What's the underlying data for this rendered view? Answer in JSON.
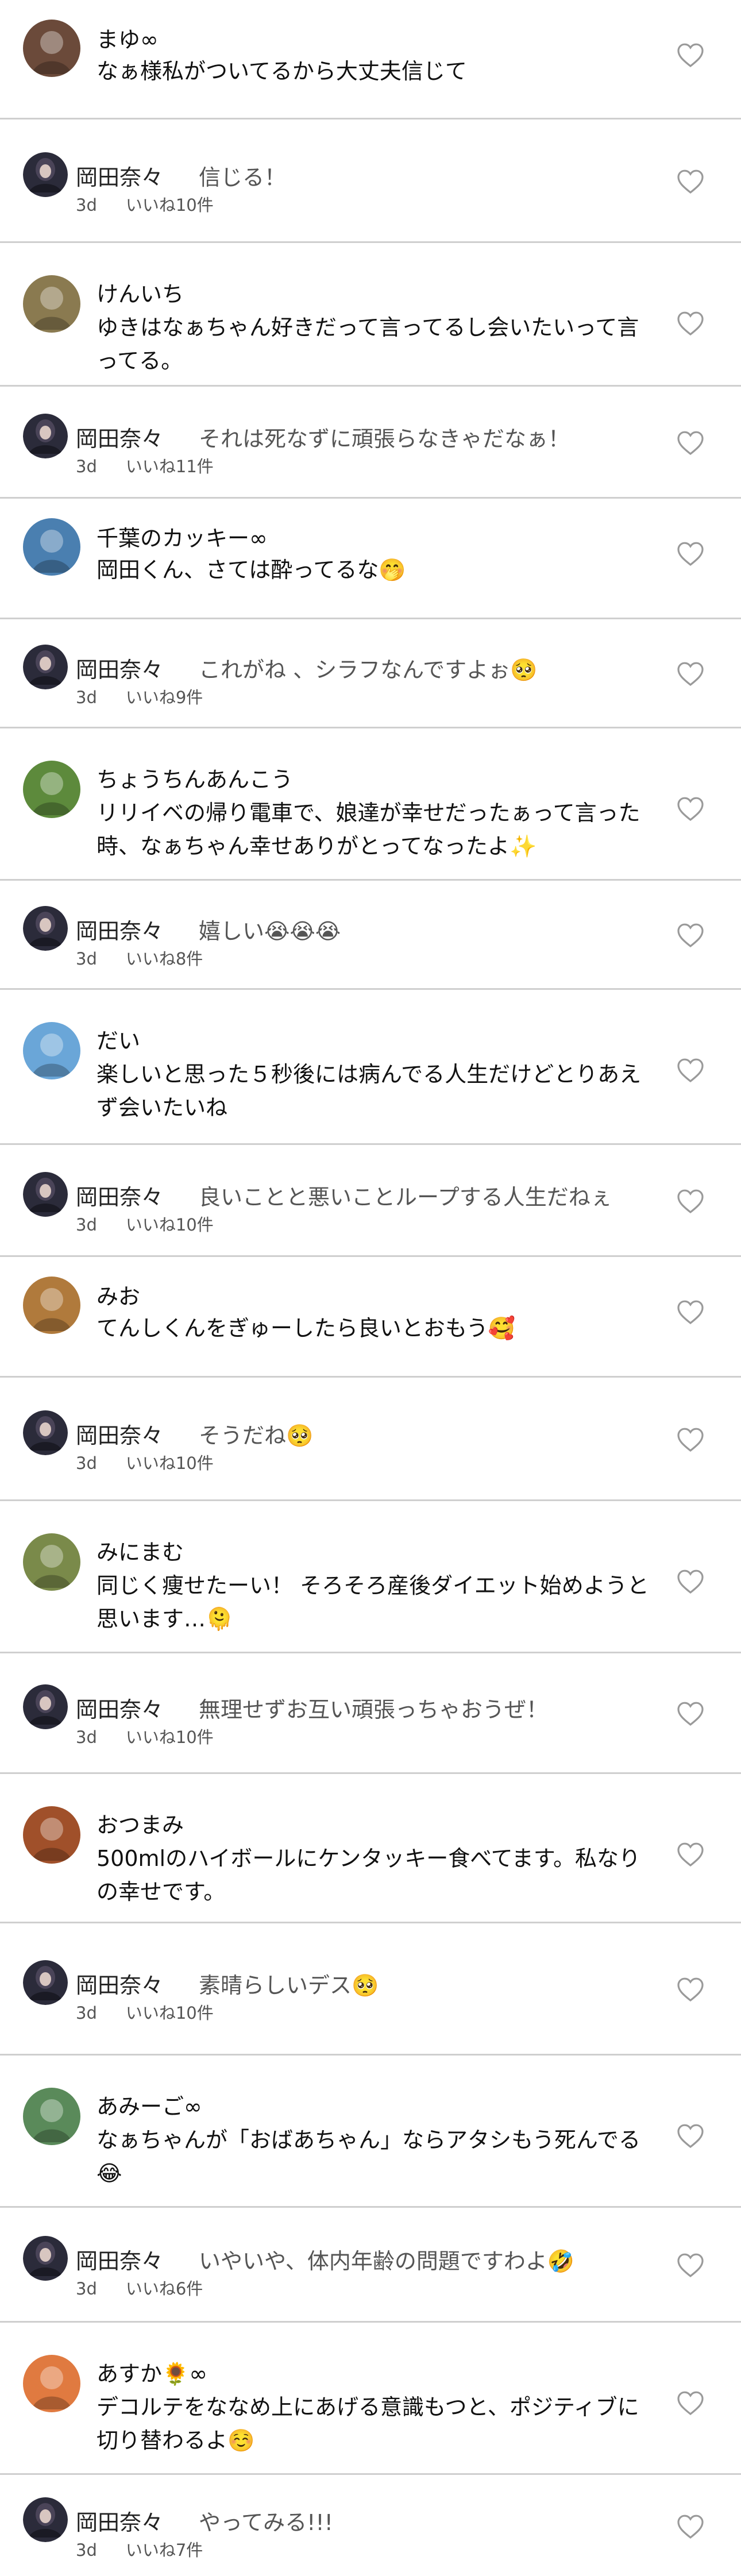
{
  "comments": [
    {
      "kind": "comment",
      "user": "まゆ∞",
      "text": "なぁ様私がついてるから大丈夫信じて",
      "avatar_color": "#6b4a3a"
    },
    {
      "kind": "reply",
      "user": "岡田奈々",
      "text": "信じる！",
      "time": "3d",
      "likes": "いいね10件"
    },
    {
      "kind": "comment",
      "user": "けんいち",
      "text": "ゆきはなぁちゃん好きだって言ってるし会いたいって言ってる。",
      "avatar_color": "#8a7a50"
    },
    {
      "kind": "reply",
      "user": "岡田奈々",
      "text": "それは死なずに頑張らなきゃだなぁ！",
      "time": "3d",
      "likes": "いいね11件"
    },
    {
      "kind": "comment",
      "user": "千葉のカッキー∞",
      "text": "岡田くん、さては酔ってるな🤭",
      "avatar_color": "#4a7fb0"
    },
    {
      "kind": "reply",
      "user": "岡田奈々",
      "text": "これがね 、シラフなんですよぉ🥺",
      "time": "3d",
      "likes": "いいね9件"
    },
    {
      "kind": "comment",
      "user": "ちょうちんあんこう",
      "text": "リリイベの帰り電車で、娘達が幸せだったぁって言った時、なぁちゃん幸せありがとってなったよ✨",
      "avatar_color": "#5d8a3c"
    },
    {
      "kind": "reply",
      "user": "岡田奈々",
      "text": "嬉しい😭😭😭",
      "time": "3d",
      "likes": "いいね8件"
    },
    {
      "kind": "comment",
      "user": "だい",
      "text": "楽しいと思った５秒後には病んでる人生だけどとりあえず会いたいね",
      "avatar_color": "#6aa6d8"
    },
    {
      "kind": "reply",
      "user": "岡田奈々",
      "text": "良いことと悪いことループする人生だねぇ",
      "time": "3d",
      "likes": "いいね10件"
    },
    {
      "kind": "comment",
      "user": "みお",
      "text": "てんしくんをぎゅーしたら良いとおもう🥰",
      "avatar_color": "#b07a3c"
    },
    {
      "kind": "reply",
      "user": "岡田奈々",
      "text": "そうだね🥺",
      "time": "3d",
      "likes": "いいね10件"
    },
    {
      "kind": "comment",
      "user": "みにまむ",
      "text": "同じく痩せたーい！ そろそろ産後ダイエット始めようと思います…🫠",
      "avatar_color": "#7a8a4a"
    },
    {
      "kind": "reply",
      "user": "岡田奈々",
      "text": "無理せずお互い頑張っちゃおうぜ！",
      "time": "3d",
      "likes": "いいね10件"
    },
    {
      "kind": "comment",
      "user": "おつまみ",
      "text": "500mlのハイボールにケンタッキー食べてます。私なりの幸せです。",
      "avatar_color": "#a0502a"
    },
    {
      "kind": "reply",
      "user": "岡田奈々",
      "text": "素晴らしいデス🥺",
      "time": "3d",
      "likes": "いいね10件"
    },
    {
      "kind": "comment",
      "user": "あみーご∞",
      "text": "なぁちゃんが「おばあちゃん」ならアタシもう死んでる😂",
      "avatar_color": "#5a8a5a"
    },
    {
      "kind": "reply",
      "user": "岡田奈々",
      "text": "いやいや、体内年齢の問題ですわよ🤣",
      "time": "3d",
      "likes": "いいね6件"
    },
    {
      "kind": "comment",
      "user": "あすか🌻∞",
      "text": "デコルテをななめ上にあげる意識もつと、ポジティブに切り替わるよ☺️",
      "avatar_color": "#e07a40"
    },
    {
      "kind": "reply",
      "user": "岡田奈々",
      "text": "やってみる!!!",
      "time": "3d",
      "likes": "いいね7件"
    }
  ],
  "colors": {
    "divider": "#cfcfcf",
    "reply_text": "#555555",
    "meta_text": "#555555",
    "heart_stroke": "#9a9a9a"
  },
  "icons": {
    "heart": "heart-outline-icon"
  }
}
